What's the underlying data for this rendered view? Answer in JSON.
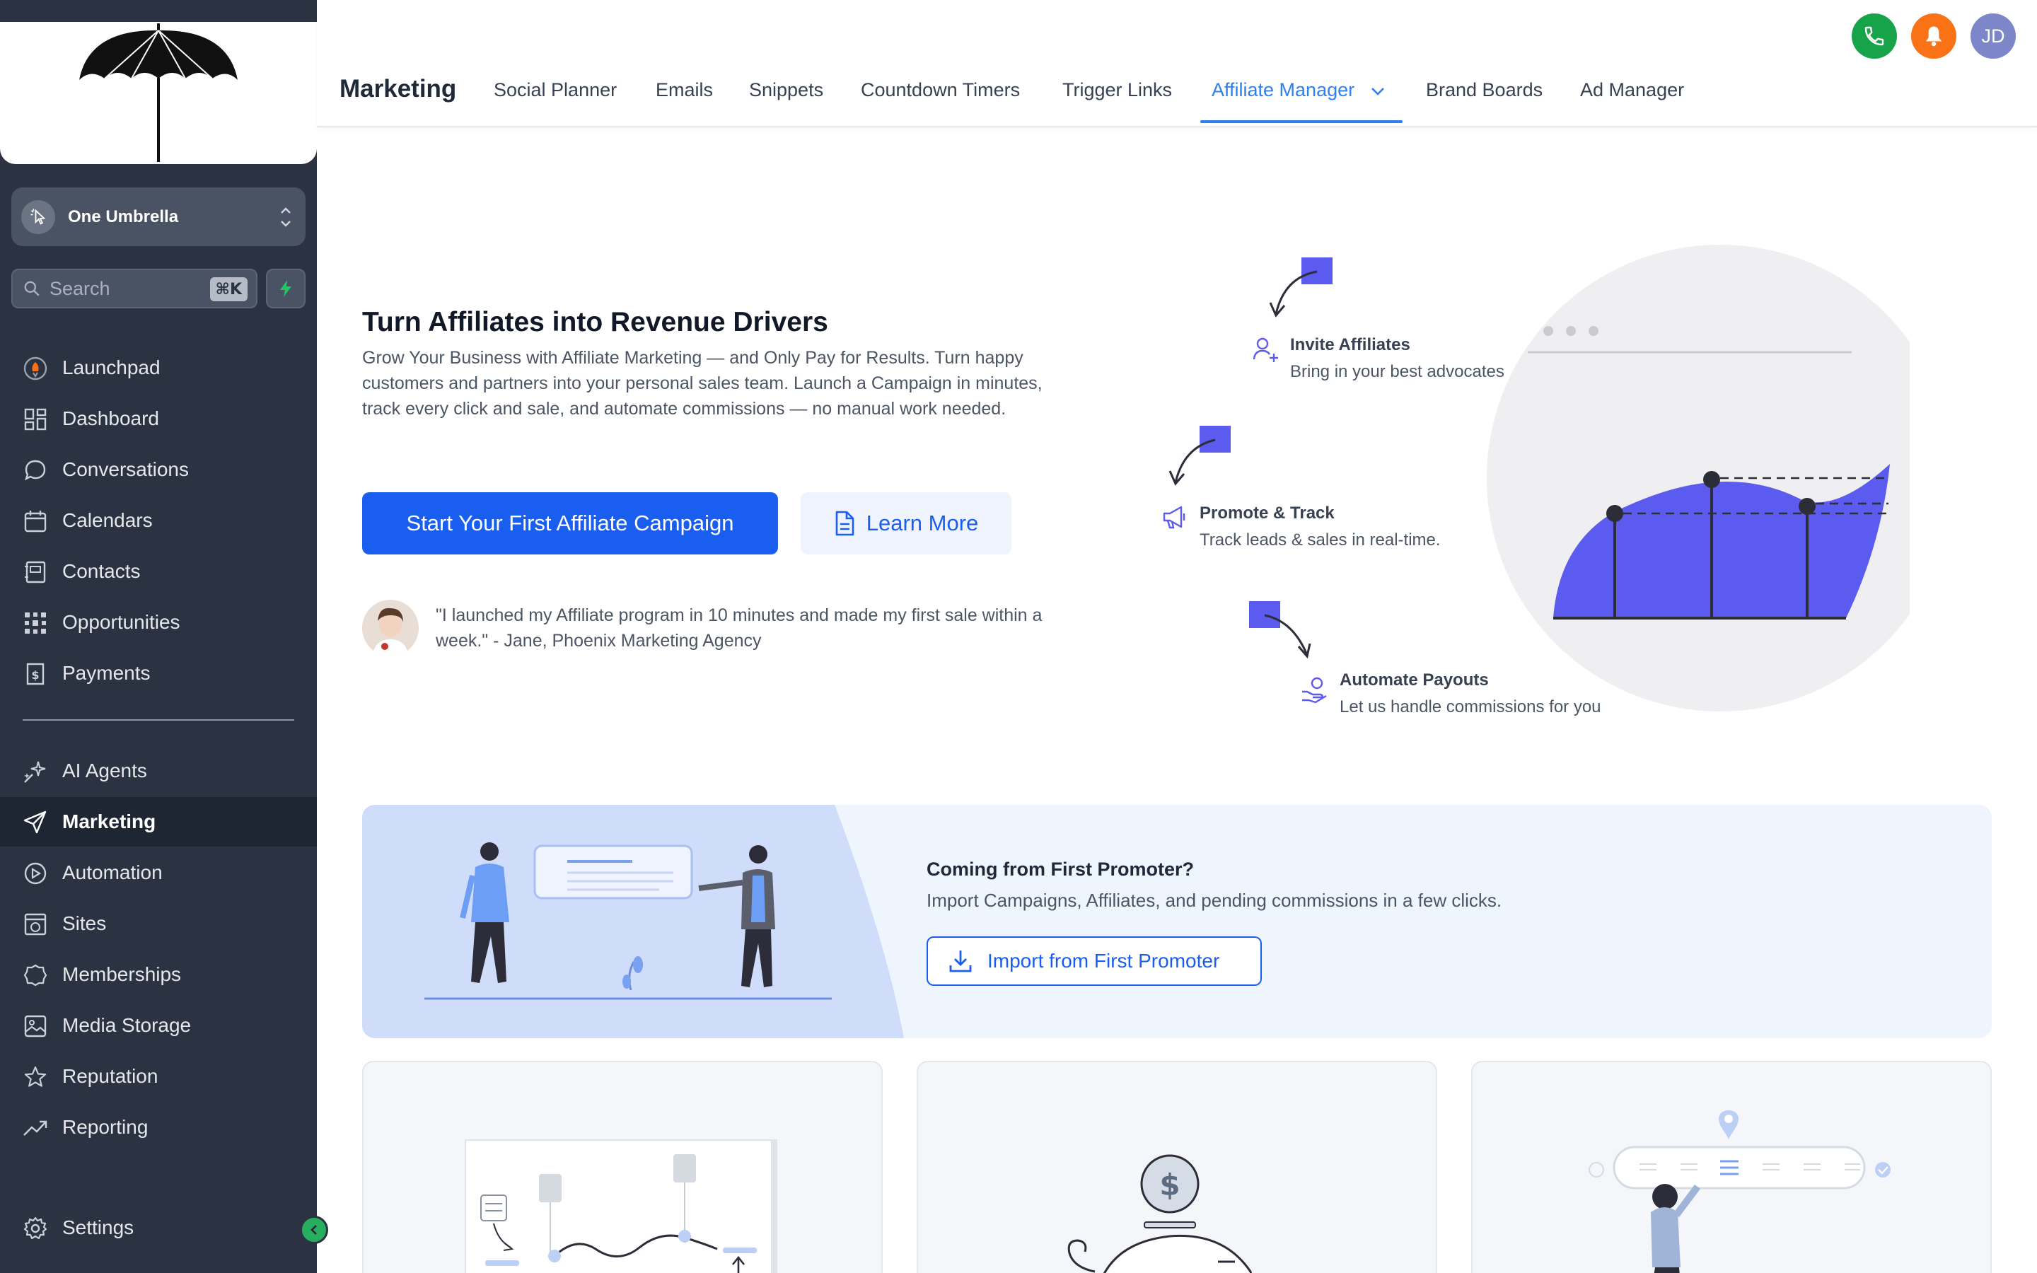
{
  "sidebar": {
    "location": {
      "name": "One Umbrella"
    },
    "search": {
      "placeholder": "Search",
      "shortcut": "⌘K"
    },
    "nav_primary": [
      {
        "label": "Launchpad",
        "icon": "rocket-icon"
      },
      {
        "label": "Dashboard",
        "icon": "grid-icon"
      },
      {
        "label": "Conversations",
        "icon": "chat-icon"
      },
      {
        "label": "Calendars",
        "icon": "calendar-icon"
      },
      {
        "label": "Contacts",
        "icon": "contacts-icon"
      },
      {
        "label": "Opportunities",
        "icon": "network-icon"
      },
      {
        "label": "Payments",
        "icon": "receipt-icon"
      }
    ],
    "nav_secondary": [
      {
        "label": "AI Agents",
        "icon": "sparkle-icon"
      },
      {
        "label": "Marketing",
        "icon": "paper-plane-icon",
        "active": true
      },
      {
        "label": "Automation",
        "icon": "automation-icon"
      },
      {
        "label": "Sites",
        "icon": "sites-icon"
      },
      {
        "label": "Memberships",
        "icon": "badge-icon"
      },
      {
        "label": "Media Storage",
        "icon": "image-icon"
      },
      {
        "label": "Reputation",
        "icon": "star-icon"
      },
      {
        "label": "Reporting",
        "icon": "trend-icon"
      }
    ],
    "settings_label": "Settings"
  },
  "header": {
    "title": "Marketing",
    "tabs": [
      {
        "label": "Social Planner"
      },
      {
        "label": "Emails"
      },
      {
        "label": "Snippets"
      },
      {
        "label": "Countdown Timers"
      },
      {
        "label": "Trigger Links"
      },
      {
        "label": "Affiliate Manager",
        "active": true
      },
      {
        "label": "Brand Boards"
      },
      {
        "label": "Ad Manager"
      }
    ],
    "user_initials": "JD"
  },
  "hero": {
    "title": "Turn Affiliates into Revenue Drivers",
    "description": "Grow Your Business with Affiliate Marketing — and Only Pay for Results. Turn happy customers and partners into your personal sales team. Launch a Campaign in minutes, track every click and sale, and automate commissions — no manual work needed.",
    "primary_cta": "Start Your First Affiliate Campaign",
    "secondary_cta": "Learn More",
    "testimonial": "\"I launched my Affiliate program in 10 minutes and made my first sale within a week.\" - Jane, Phoenix Marketing Agency",
    "steps": [
      {
        "title": "Invite Affiliates",
        "desc": "Bring in your best advocates"
      },
      {
        "title": "Promote & Track",
        "desc": "Track leads & sales in real-time."
      },
      {
        "title": "Automate Payouts",
        "desc": "Let us handle commissions for you"
      }
    ]
  },
  "import_banner": {
    "title": "Coming from First Promoter?",
    "description": "Import Campaigns, Affiliates, and pending commissions in a few clicks.",
    "button": "Import from First Promoter"
  },
  "colors": {
    "sidebar_bg": "#2b3342",
    "primary": "#1a5ef0",
    "accent_purple": "#6366f1",
    "phone_green": "#17a34a",
    "bell_orange": "#f97316",
    "avatar_purple": "#7c86c9"
  }
}
